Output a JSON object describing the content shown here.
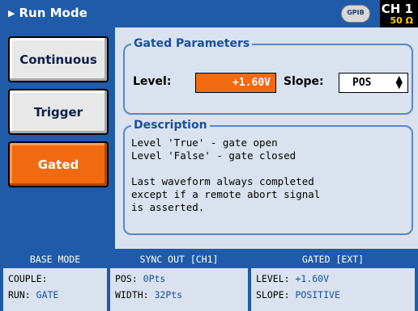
{
  "header": {
    "title": "Run Mode",
    "gpib_label": "GPIB",
    "channel": "CH 1",
    "impedance": "50 Ω"
  },
  "modes": [
    {
      "label": "Continuous",
      "active": false
    },
    {
      "label": "Trigger",
      "active": false
    },
    {
      "label": "Gated",
      "active": true
    }
  ],
  "gated_parameters": {
    "legend": "Gated Parameters",
    "level_label": "Level:",
    "level_value": "+1.60V",
    "slope_label": "Slope:",
    "slope_value": "POS"
  },
  "description": {
    "legend": "Description",
    "text": "Level 'True' - gate open\nLevel 'False' - gate closed\n\nLast waveform always completed\nexcept if a remote abort signal\nis asserted."
  },
  "status": {
    "base_mode": {
      "header": "BASE MODE",
      "couple_label": "COUPLE:",
      "couple_value": "",
      "run_label": "RUN:",
      "run_value": "GATE"
    },
    "sync_out": {
      "header": "SYNC OUT [CH1]",
      "pos_label": "POS:",
      "pos_value": "0Pts",
      "width_label": "WIDTH:",
      "width_value": "32Pts"
    },
    "gated": {
      "header": "GATED [EXT]",
      "level_label": "LEVEL:",
      "level_value": "+1.60V",
      "slope_label": "SLOPE:",
      "slope_value": "POSITIVE"
    }
  },
  "colors": {
    "accent": "#1f5ba8",
    "active": "#f26a10",
    "panel": "#d9e2ee",
    "value_text": "#1a4fa0"
  }
}
